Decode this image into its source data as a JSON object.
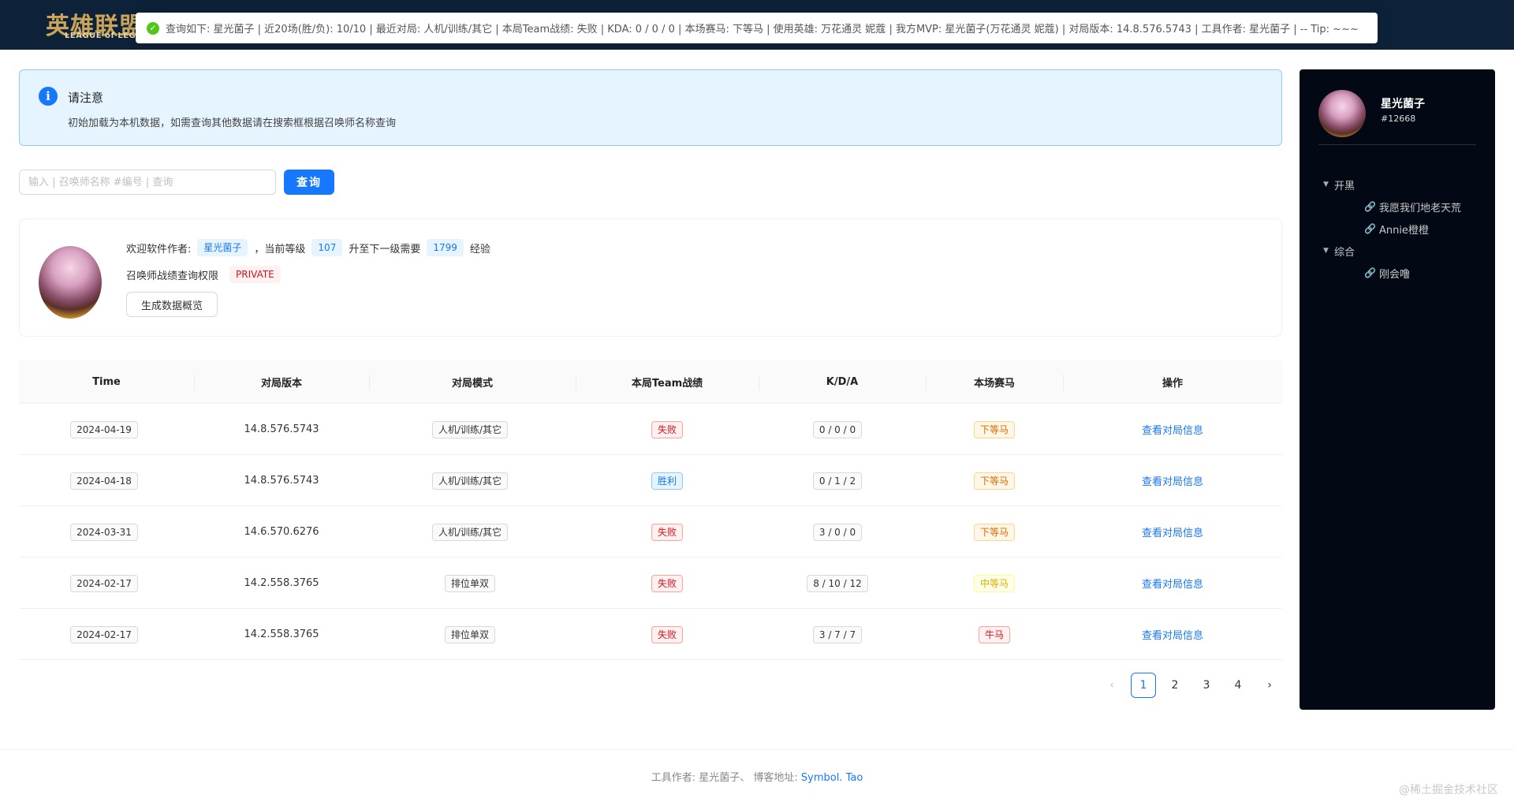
{
  "header": {
    "logo_cn": "英雄联盟",
    "logo_en": "LEAGUE of LEGENDS",
    "toast": "查询如下: 星光菌子 | 近20场(胜/负): 10/10 | 最近对局: 人机/训练/其它 | 本局Team战绩: 失败 | KDA: 0 / 0 / 0 | 本场赛马: 下等马 | 使用英雄: 万花通灵 妮蔻 | 我方MVP: 星光菌子(万花通灵 妮蔻) | 对局版本: 14.8.576.5743 | 工具作者: 星光菌子 | -- Tip: ~~~"
  },
  "notice": {
    "title": "请注意",
    "desc": "初始加载为本机数据，如需查询其他数据请在搜索框根据召唤师名称查询"
  },
  "search": {
    "placeholder": "输入 | 召唤师名称 #编号 | 查询",
    "button": "查询"
  },
  "profile": {
    "welcome": "欢迎软件作者:",
    "name": "星光菌子",
    "level_label": "，当前等级",
    "level": "107",
    "next_label": "升至下一级需要",
    "exp_needed": "1799",
    "exp_unit": "经验",
    "permission_label": "召唤师战绩查询权限",
    "permission": "PRIVATE",
    "generate_button": "生成数据概览"
  },
  "table": {
    "headers": [
      "Time",
      "对局版本",
      "对局模式",
      "本局Team战绩",
      "K/D/A",
      "本场赛马",
      "操作"
    ],
    "rows": [
      {
        "time": "2024-04-19",
        "version": "14.8.576.5743",
        "mode": "人机/训练/其它",
        "result": "失败",
        "kda": "0 / 0 / 0",
        "horse": "下等马",
        "action": "查看对局信息"
      },
      {
        "time": "2024-04-18",
        "version": "14.8.576.5743",
        "mode": "人机/训练/其它",
        "result": "胜利",
        "kda": "0 / 1 / 2",
        "horse": "下等马",
        "action": "查看对局信息"
      },
      {
        "time": "2024-03-31",
        "version": "14.6.570.6276",
        "mode": "人机/训练/其它",
        "result": "失败",
        "kda": "3 / 0 / 0",
        "horse": "下等马",
        "action": "查看对局信息"
      },
      {
        "time": "2024-02-17",
        "version": "14.2.558.3765",
        "mode": "排位单双",
        "result": "失败",
        "kda": "8 / 10 / 12",
        "horse": "中等马",
        "action": "查看对局信息"
      },
      {
        "time": "2024-02-17",
        "version": "14.2.558.3765",
        "mode": "排位单双",
        "result": "失败",
        "kda": "3 / 7 / 7",
        "horse": "牛马",
        "action": "查看对局信息"
      }
    ]
  },
  "pagination": {
    "prev": "‹",
    "pages": [
      "1",
      "2",
      "3",
      "4"
    ],
    "next": "›",
    "current": "1"
  },
  "footer": {
    "text": "工具作者: 星光菌子、 博客地址:",
    "blog": "Symbol. Tao",
    "watermark": "@稀土掘金技术社区"
  },
  "sidebar": {
    "name": "星光菌子",
    "tag": "#12668",
    "tree": [
      {
        "label": "开黑",
        "children": [
          "我愿我们地老天荒",
          "Annie橙橙"
        ]
      },
      {
        "label": "综合",
        "children": [
          "刚会噜"
        ]
      }
    ]
  }
}
